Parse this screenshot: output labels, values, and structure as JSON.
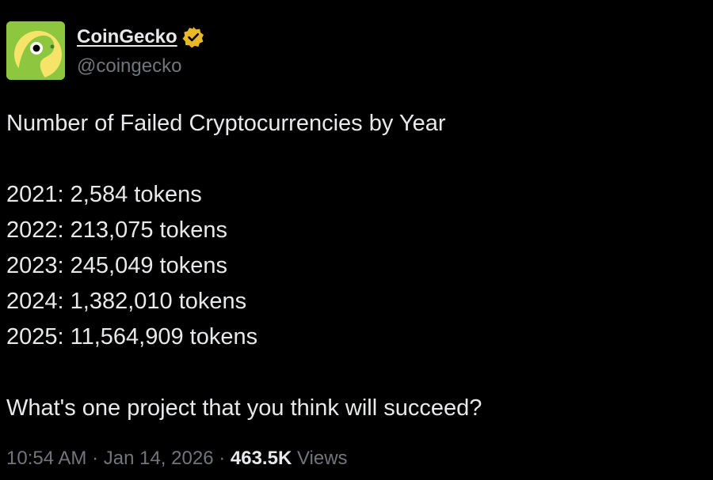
{
  "author": {
    "display_name": "CoinGecko",
    "handle": "@coingecko",
    "verified": true,
    "avatar_icon": "gecko-logo-icon",
    "avatar_color": "#8dc63f",
    "verified_color": "#e8b829"
  },
  "tweet": {
    "title": "Number of Failed Cryptocurrencies by Year",
    "lines": [
      "2021: 2,584 tokens",
      "2022: 213,075 tokens",
      "2023: 245,049 tokens",
      "2024: 1,382,010 tokens",
      "2025: 11,564,909 tokens"
    ],
    "question": "What's one project that you think will succeed?"
  },
  "meta": {
    "time": "10:54 AM",
    "separator": "·",
    "date": "Jan 14, 2026",
    "views_count": "463.5K",
    "views_label": "Views"
  }
}
